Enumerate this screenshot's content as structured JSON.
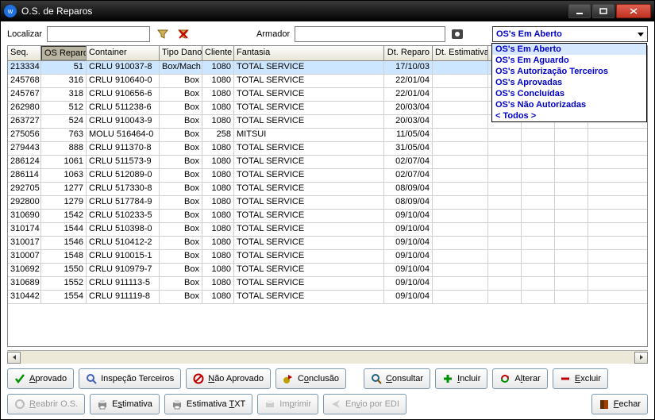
{
  "window": {
    "title": "O.S. de Reparos"
  },
  "toolbar": {
    "localizar_label": "Localizar",
    "armador_label": "Armador"
  },
  "filter": {
    "selected": "OS's Em Aberto",
    "options": [
      "OS's Em Aberto",
      "OS's Em Aguardo",
      "OS's Autorização Terceiros",
      "OS's Aprovadas",
      "OS's Concluídas",
      "OS's Não Autorizadas",
      "< Todos >"
    ]
  },
  "grid": {
    "headers": [
      "Seq.",
      "OS Reparo",
      "Container",
      "Tipo Dano",
      "Cliente",
      "Fantasia",
      "Dt. Reparo",
      "Dt. Estimativa",
      "",
      "",
      ""
    ],
    "pressedIndex": 1,
    "rows": [
      {
        "seq": "213334",
        "os": "51",
        "container": "CRLU 910037-8",
        "tipo": "Box/Mach.",
        "cliente": "1080",
        "fantasia": "TOTAL SERVICE",
        "dtrep": "17/10/03",
        "dtest": "",
        "sel": true
      },
      {
        "seq": "245768",
        "os": "316",
        "container": "CRLU 910640-0",
        "tipo": "Box",
        "cliente": "1080",
        "fantasia": "TOTAL SERVICE",
        "dtrep": "22/01/04",
        "dtest": ""
      },
      {
        "seq": "245767",
        "os": "318",
        "container": "CRLU 910656-6",
        "tipo": "Box",
        "cliente": "1080",
        "fantasia": "TOTAL SERVICE",
        "dtrep": "22/01/04",
        "dtest": ""
      },
      {
        "seq": "262980",
        "os": "512",
        "container": "CRLU 511238-6",
        "tipo": "Box",
        "cliente": "1080",
        "fantasia": "TOTAL SERVICE",
        "dtrep": "20/03/04",
        "dtest": ""
      },
      {
        "seq": "263727",
        "os": "524",
        "container": "CRLU 910043-9",
        "tipo": "Box",
        "cliente": "1080",
        "fantasia": "TOTAL SERVICE",
        "dtrep": "20/03/04",
        "dtest": ""
      },
      {
        "seq": "275056",
        "os": "763",
        "container": "MOLU 516464-0",
        "tipo": "Box",
        "cliente": "258",
        "fantasia": "MITSUI",
        "dtrep": "11/05/04",
        "dtest": ""
      },
      {
        "seq": "279443",
        "os": "888",
        "container": "CRLU 911370-8",
        "tipo": "Box",
        "cliente": "1080",
        "fantasia": "TOTAL SERVICE",
        "dtrep": "31/05/04",
        "dtest": ""
      },
      {
        "seq": "286124",
        "os": "1061",
        "container": "CRLU 511573-9",
        "tipo": "Box",
        "cliente": "1080",
        "fantasia": "TOTAL SERVICE",
        "dtrep": "02/07/04",
        "dtest": ""
      },
      {
        "seq": "286114",
        "os": "1063",
        "container": "CRLU 512089-0",
        "tipo": "Box",
        "cliente": "1080",
        "fantasia": "TOTAL SERVICE",
        "dtrep": "02/07/04",
        "dtest": ""
      },
      {
        "seq": "292705",
        "os": "1277",
        "container": "CRLU 517330-8",
        "tipo": "Box",
        "cliente": "1080",
        "fantasia": "TOTAL SERVICE",
        "dtrep": "08/09/04",
        "dtest": ""
      },
      {
        "seq": "292800",
        "os": "1279",
        "container": "CRLU 517784-9",
        "tipo": "Box",
        "cliente": "1080",
        "fantasia": "TOTAL SERVICE",
        "dtrep": "08/09/04",
        "dtest": ""
      },
      {
        "seq": "310690",
        "os": "1542",
        "container": "CRLU 510233-5",
        "tipo": "Box",
        "cliente": "1080",
        "fantasia": "TOTAL SERVICE",
        "dtrep": "09/10/04",
        "dtest": ""
      },
      {
        "seq": "310174",
        "os": "1544",
        "container": "CRLU 510398-0",
        "tipo": "Box",
        "cliente": "1080",
        "fantasia": "TOTAL SERVICE",
        "dtrep": "09/10/04",
        "dtest": ""
      },
      {
        "seq": "310017",
        "os": "1546",
        "container": "CRLU 510412-2",
        "tipo": "Box",
        "cliente": "1080",
        "fantasia": "TOTAL SERVICE",
        "dtrep": "09/10/04",
        "dtest": ""
      },
      {
        "seq": "310007",
        "os": "1548",
        "container": "CRLU 910015-1",
        "tipo": "Box",
        "cliente": "1080",
        "fantasia": "TOTAL SERVICE",
        "dtrep": "09/10/04",
        "dtest": ""
      },
      {
        "seq": "310692",
        "os": "1550",
        "container": "CRLU 910979-7",
        "tipo": "Box",
        "cliente": "1080",
        "fantasia": "TOTAL SERVICE",
        "dtrep": "09/10/04",
        "dtest": ""
      },
      {
        "seq": "310689",
        "os": "1552",
        "container": "CRLU 911113-5",
        "tipo": "Box",
        "cliente": "1080",
        "fantasia": "TOTAL SERVICE",
        "dtrep": "09/10/04",
        "dtest": ""
      },
      {
        "seq": "310442",
        "os": "1554",
        "container": "CRLU 911119-8",
        "tipo": "Box",
        "cliente": "1080",
        "fantasia": "TOTAL SERVICE",
        "dtrep": "09/10/04",
        "dtest": ""
      }
    ]
  },
  "buttons": {
    "aprovado": "Aprovado",
    "inspecao": "Inspeção Terceiros",
    "naoaprov": "Não Aprovado",
    "conclusao": "Conclusão",
    "consultar": "Consultar",
    "incluir": "Incluir",
    "alterar": "Alterar",
    "excluir": "Excluir",
    "reabrir": "Reabrir O.S.",
    "estimativa": "Estimativa",
    "estimativatxt": "Estimativa TXT",
    "imprimir": "Imprimir",
    "envioedi": "Envio por EDI",
    "fechar": "Fechar"
  }
}
